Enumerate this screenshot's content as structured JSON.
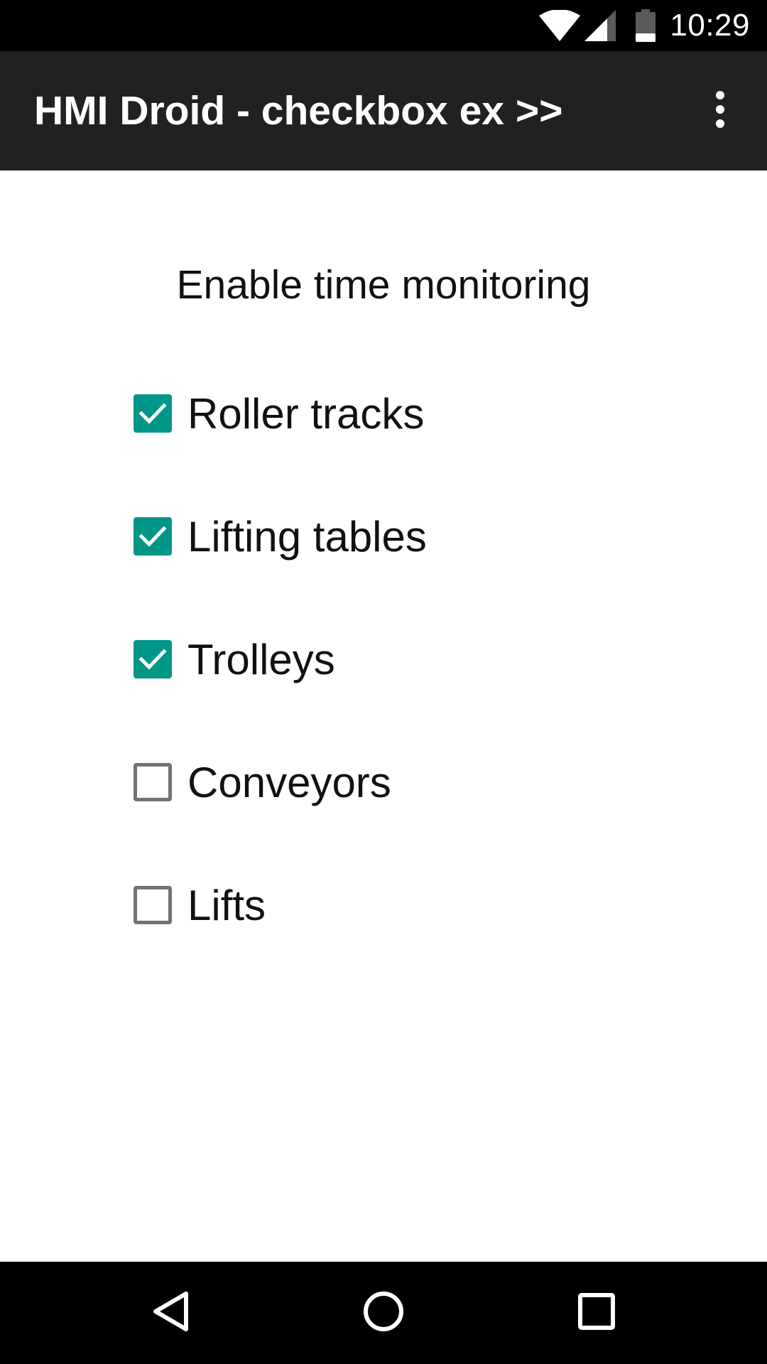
{
  "status_bar": {
    "time": "10:29",
    "icons": [
      "wifi-icon",
      "cell-signal-icon",
      "battery-icon"
    ]
  },
  "app_bar": {
    "title": "HMI Droid - checkbox ex >>",
    "overflow_icon": "more-vert-icon"
  },
  "main": {
    "heading": "Enable time monitoring",
    "checkboxes": [
      {
        "label": "Roller tracks",
        "checked": true
      },
      {
        "label": "Lifting tables",
        "checked": true
      },
      {
        "label": "Trolleys",
        "checked": true
      },
      {
        "label": "Conveyors",
        "checked": false
      },
      {
        "label": "Lifts",
        "checked": false
      }
    ]
  },
  "nav_bar": {
    "buttons": [
      "back-icon",
      "home-icon",
      "recents-icon"
    ]
  },
  "colors": {
    "checkbox_checked": "#009688",
    "checkbox_unchecked_border": "#737373",
    "app_bar": "#212121",
    "system_bars": "#000000"
  }
}
